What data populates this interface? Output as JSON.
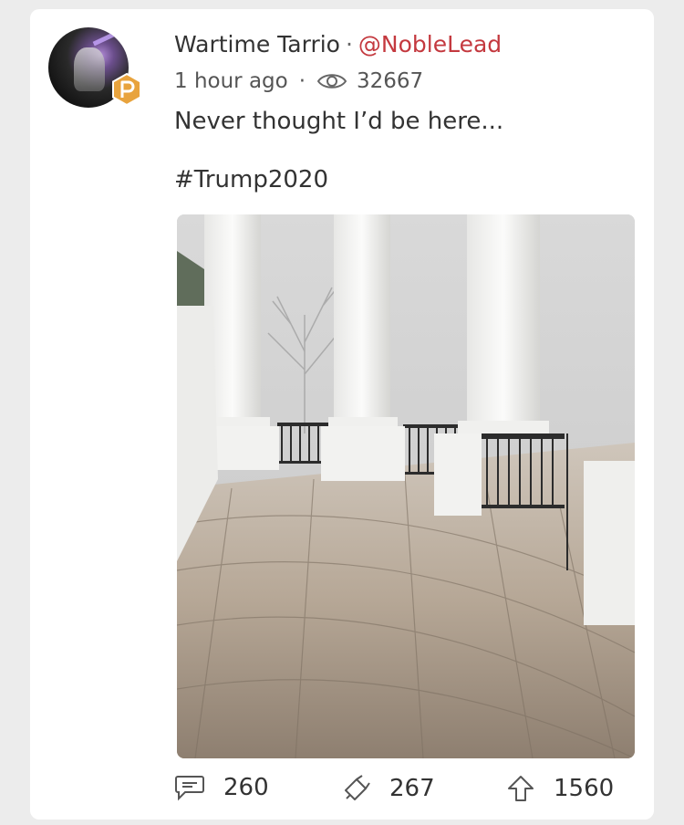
{
  "post": {
    "author_name": "Wartime Tarrio",
    "separator": "·",
    "handle": "@NobleLead",
    "time": "1 hour ago",
    "meta_separator": "·",
    "views": "32667",
    "text": "Never thought I’d be here...",
    "hashtag": "#Trump2020"
  },
  "actions": {
    "comments": "260",
    "echoes": "267",
    "upvotes": "1560"
  },
  "colors": {
    "handle": "#c4393f",
    "badge": "#e8a33d",
    "card_bg": "#ffffff",
    "page_bg": "#ececec"
  },
  "icons": {
    "badge": "parler-p-badge-icon",
    "views": "eye-icon",
    "comments": "comment-bubble-icon",
    "echoes": "echo-megaphone-icon",
    "upvotes": "upvote-arrow-icon"
  }
}
